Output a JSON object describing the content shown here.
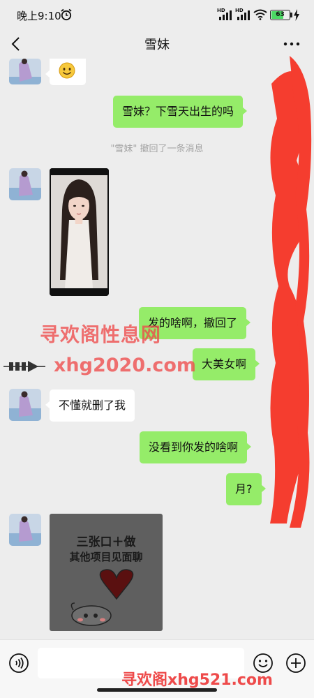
{
  "status_bar": {
    "time": "晚上9:10",
    "signal_label_1": "HD",
    "signal_label_2": "HD",
    "battery_level": "63"
  },
  "nav": {
    "title": "雪妹"
  },
  "messages": [
    {
      "side": "in",
      "type": "emoji",
      "icon": "smiley-emoji-icon"
    },
    {
      "side": "out",
      "type": "text",
      "text": "雪妹？下雪天出生的吗"
    },
    {
      "side": "system",
      "type": "recall",
      "text": "\"雪妹\" 撤回了一条消息"
    },
    {
      "side": "in",
      "type": "image",
      "icon": "photo-image"
    },
    {
      "side": "out",
      "type": "text",
      "text": "发的啥啊，撤回了"
    },
    {
      "side": "out",
      "type": "text",
      "text": "大美女啊"
    },
    {
      "side": "in",
      "type": "text",
      "text": "不懂就删了我"
    },
    {
      "side": "out",
      "type": "text",
      "text": "没看到你发的啥啊"
    },
    {
      "side": "out",
      "type": "text",
      "text": "月?"
    },
    {
      "side": "in",
      "type": "sticker",
      "line1": "三张口＋做",
      "line2": "其他项目见面聊"
    }
  ],
  "watermarks": {
    "wm1": "寻欢阁性息网",
    "wm2": "xhg2020.com",
    "wm3": "寻欢阁xhg521.com"
  },
  "input_bar": {
    "value": "",
    "placeholder": ""
  },
  "colors": {
    "background": "#ededed",
    "outgoing_bubble": "#95ec69",
    "incoming_bubble": "#ffffff",
    "redaction": "#f53d2f",
    "watermark": "#ee4a4a"
  }
}
